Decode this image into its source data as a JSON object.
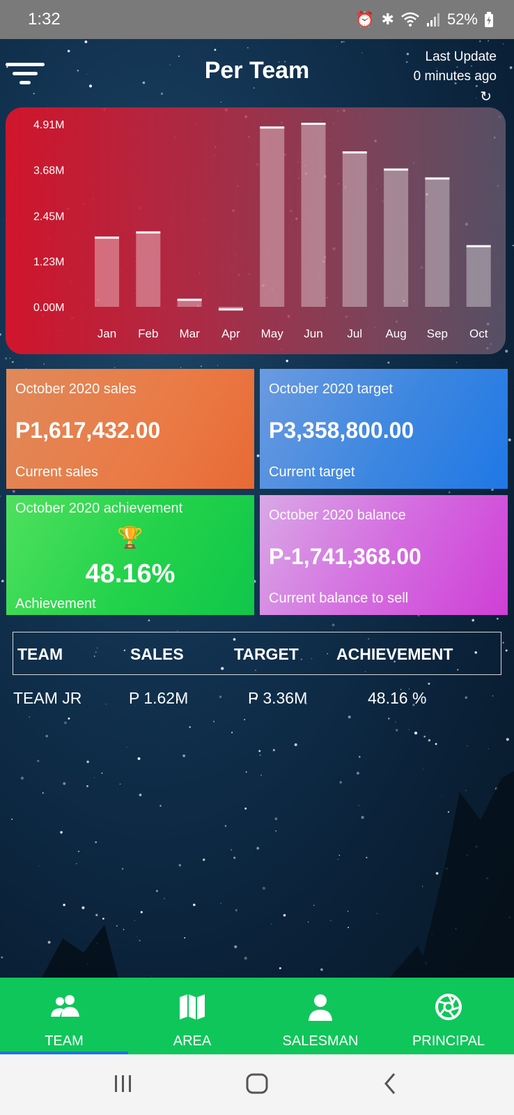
{
  "status_bar": {
    "time": "1:32",
    "battery": "52%",
    "icons": [
      "alarm-icon",
      "bluetooth-icon",
      "wifi-icon",
      "signal-icon",
      "battery-icon"
    ]
  },
  "header": {
    "title": "Per Team",
    "last_update_label": "Last Update",
    "last_update_value": "0 minutes ago"
  },
  "chart_data": {
    "type": "bar",
    "categories": [
      "Jan",
      "Feb",
      "Mar",
      "Apr",
      "May",
      "Jun",
      "Jul",
      "Aug",
      "Sep",
      "Oct"
    ],
    "values": [
      1.85,
      1.99,
      0.18,
      -0.08,
      4.81,
      4.91,
      4.14,
      3.68,
      3.44,
      1.62
    ],
    "yticks": [
      "0.00M",
      "1.23M",
      "2.45M",
      "3.68M",
      "4.91M"
    ],
    "ytick_values": [
      0,
      1.23,
      2.45,
      3.68,
      4.91
    ],
    "ylim": [
      -0.1,
      4.91
    ],
    "unit": "M",
    "grid": false
  },
  "cards": {
    "sales": {
      "title": "October 2020 sales",
      "value": "P1,617,432.00",
      "subtitle": "Current sales"
    },
    "target": {
      "title": "October 2020 target",
      "value": "P3,358,800.00",
      "subtitle": "Current target"
    },
    "achievement": {
      "title": "October 2020 achievement",
      "value": "48.16%",
      "subtitle": "Achievement"
    },
    "balance": {
      "title": "October 2020 balance",
      "value": "P-1,741,368.00",
      "subtitle": "Current balance to sell"
    }
  },
  "table": {
    "headers": [
      "TEAM",
      "SALES",
      "TARGET",
      "ACHIEVEMENT"
    ],
    "rows": [
      [
        "TEAM JR",
        "P 1.62M",
        "P 3.36M",
        "48.16 %"
      ]
    ]
  },
  "bottom_nav": {
    "items": [
      {
        "label": "TEAM",
        "icon": "team-icon",
        "active": true
      },
      {
        "label": "AREA",
        "icon": "map-icon",
        "active": false
      },
      {
        "label": "SALESMAN",
        "icon": "person-icon",
        "active": false
      },
      {
        "label": "PRINCIPAL",
        "icon": "aperture-icon",
        "active": false
      }
    ]
  },
  "colors": {
    "nav_bg": "#0fc65a",
    "nav_indicator": "#1b74e0",
    "chart_left": "#d6142a",
    "sales_card": "#e87a45",
    "target_card": "#2f80e4",
    "achievement_card": "#1fd04c",
    "balance_card": "#d24fd9"
  }
}
